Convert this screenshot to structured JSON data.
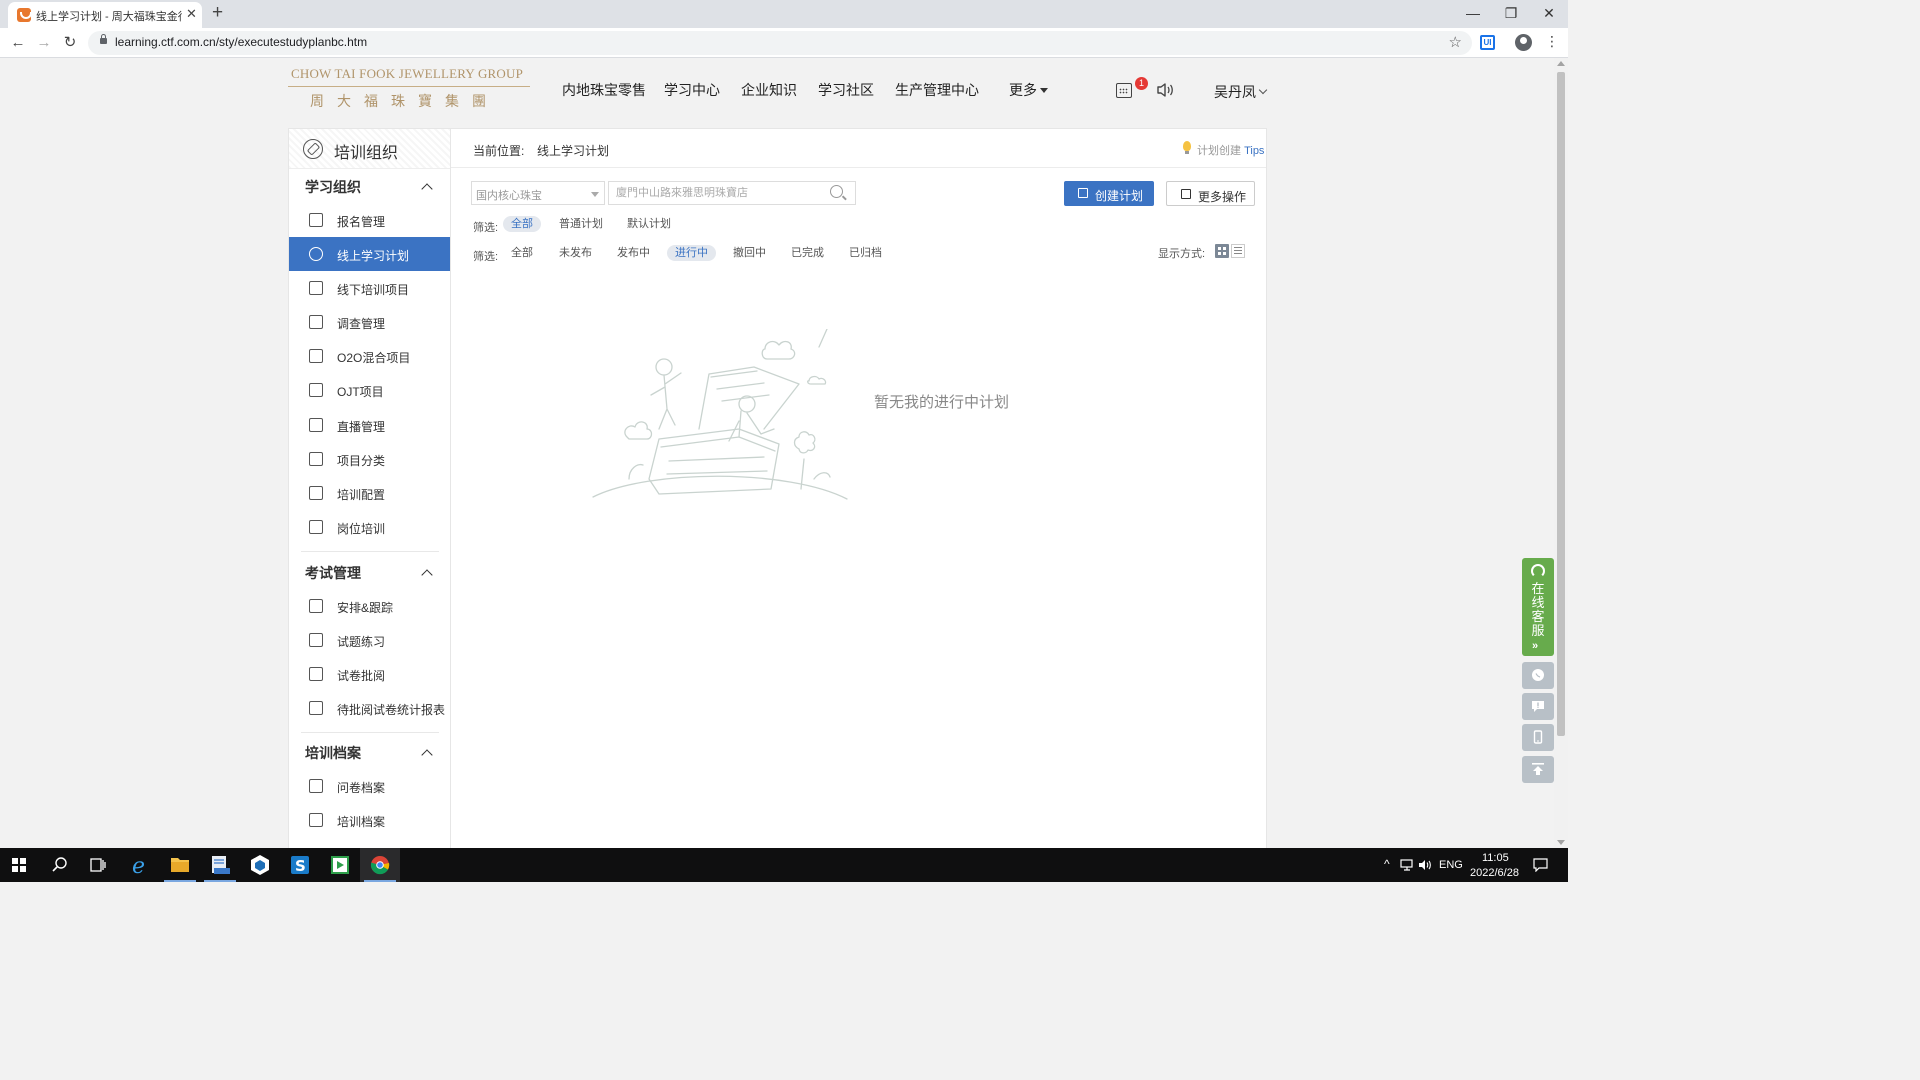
{
  "browser": {
    "tab_title": "线上学习计划 - 周大福珠宝金行",
    "tab_close": "✕",
    "new_tab": "+",
    "url": "learning.ctf.com.cn/sty/executestudyplanbc.htm",
    "window_controls": [
      "—",
      "❐",
      "✕"
    ],
    "extension_label": "UI"
  },
  "header": {
    "logo_en": "CHOW TAI FOOK JEWELLERY GROUP",
    "logo_cn": "周大福珠寶集團",
    "nav": [
      "内地珠宝零售",
      "学习中心",
      "企业知识",
      "学习社区",
      "生产管理中心"
    ],
    "more": "更多",
    "notification_count": "1",
    "user": "吴丹凤"
  },
  "sidebar": {
    "title": "培训组织",
    "sections": [
      {
        "title": "学习组织",
        "items": [
          {
            "label": "报名管理",
            "icon": "registration-icon"
          },
          {
            "label": "线上学习计划",
            "icon": "online-plan-icon",
            "active": true
          },
          {
            "label": "线下培训项目",
            "icon": "offline-training-icon"
          },
          {
            "label": "调查管理",
            "icon": "survey-icon"
          },
          {
            "label": "O2O混合项目",
            "icon": "o2o-icon"
          },
          {
            "label": "OJT项目",
            "icon": "ojt-icon"
          },
          {
            "label": "直播管理",
            "icon": "live-icon"
          },
          {
            "label": "项目分类",
            "icon": "category-icon"
          },
          {
            "label": "培训配置",
            "icon": "config-icon"
          },
          {
            "label": "岗位培训",
            "icon": "position-training-icon"
          }
        ]
      },
      {
        "title": "考试管理",
        "items": [
          {
            "label": "安排&跟踪",
            "icon": "send-icon"
          },
          {
            "label": "试题练习",
            "icon": "practice-icon"
          },
          {
            "label": "试卷批阅",
            "icon": "grading-icon"
          },
          {
            "label": "待批阅试卷统计报表",
            "icon": "report-icon"
          }
        ]
      },
      {
        "title": "培训档案",
        "items": [
          {
            "label": "问卷档案",
            "icon": "questionnaire-archive-icon"
          },
          {
            "label": "培训档案",
            "icon": "training-archive-icon"
          }
        ]
      }
    ]
  },
  "main": {
    "breadcrumb_label": "当前位置:",
    "breadcrumb_current": "线上学习计划",
    "tips_prefix": "计划创建",
    "tips_link": "Tips",
    "org_select": "国内核心珠宝",
    "search_placeholder": "廈門中山路來雅思明珠寶店",
    "create_button": "创建计划",
    "more_button": "更多操作",
    "filter_label": "筛选:",
    "filter_type": [
      "全部",
      "普通计划",
      "默认计划"
    ],
    "filter_type_selected": 0,
    "filter_status": [
      "全部",
      "未发布",
      "发布中",
      "进行中",
      "撤回中",
      "已完成",
      "已归档"
    ],
    "filter_status_selected": 3,
    "display_label": "显示方式:",
    "empty_text": "暂无我的进行中计划"
  },
  "float_service": {
    "text": "在线客服",
    "arrows": "»"
  },
  "taskbar": {
    "apps": [
      "start",
      "search",
      "task-view",
      "ie",
      "file-explorer",
      "app-blue",
      "app-cube",
      "app-s",
      "app-green",
      "chrome"
    ],
    "running_index": 9,
    "lang": "ENG",
    "time": "11:05",
    "date": "2022/6/28"
  },
  "colors": {
    "primary": "#3b73c3",
    "gold": "#b0946a",
    "service_green": "#67ab4c",
    "badge_red": "#e53935"
  }
}
